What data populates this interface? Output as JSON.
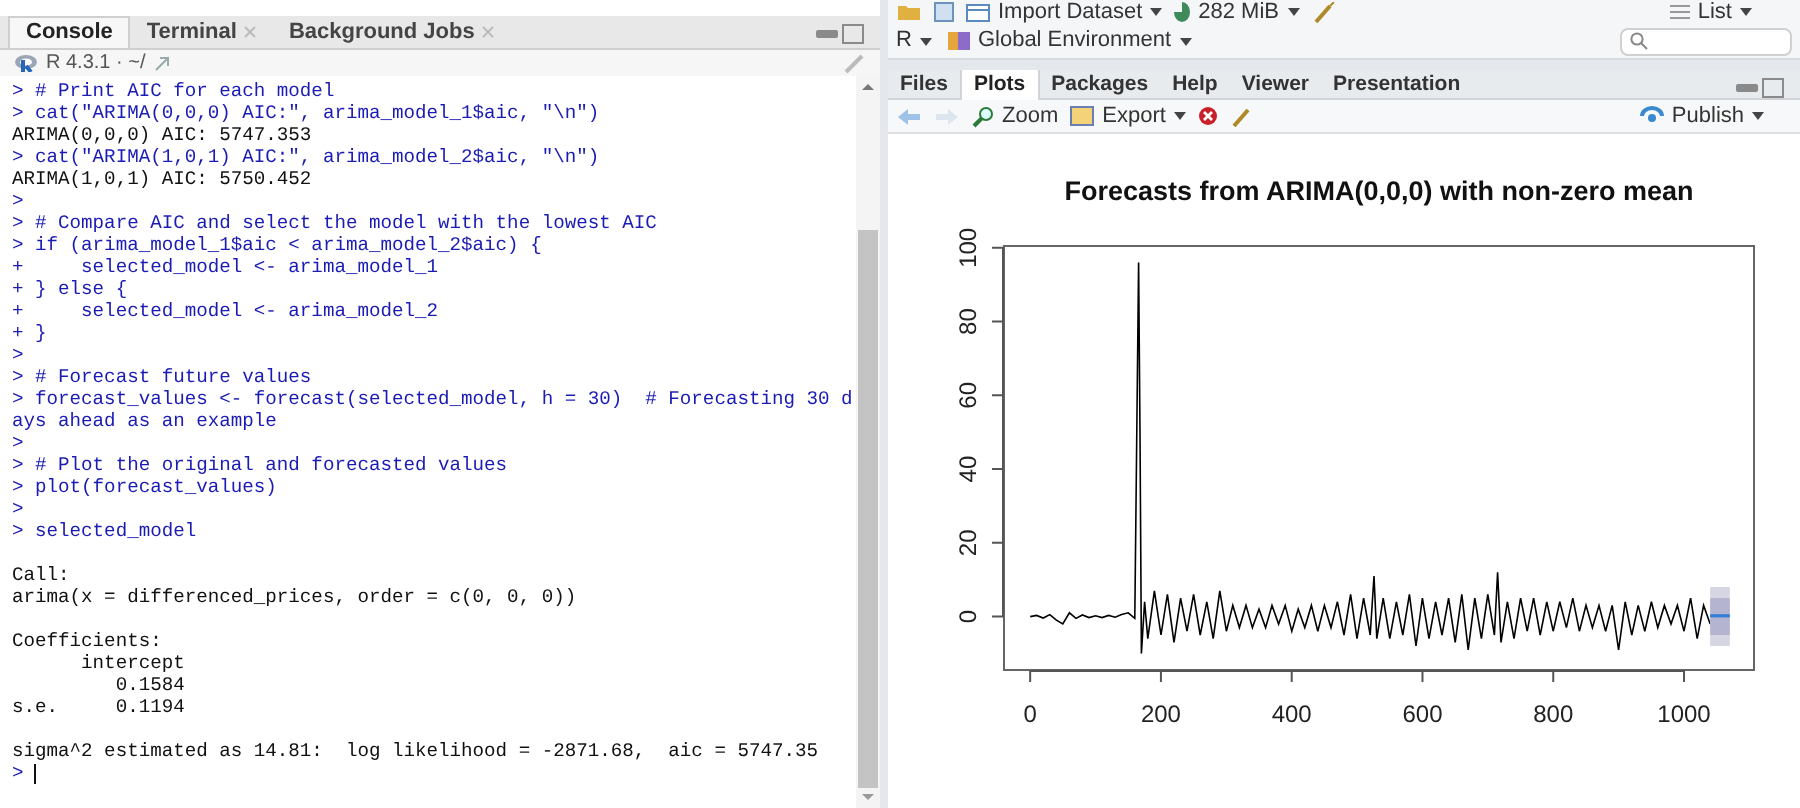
{
  "console": {
    "tabs": [
      {
        "label": "Console",
        "selected": true,
        "closable": false
      },
      {
        "label": "Terminal",
        "selected": false,
        "closable": true
      },
      {
        "label": "Background Jobs",
        "selected": false,
        "closable": true
      }
    ],
    "version_label": "R 4.3.1 · ~/",
    "lines": [
      {
        "kind": "input",
        "text": "> # Print AIC for each model"
      },
      {
        "kind": "input",
        "text": "> cat(\"ARIMA(0,0,0) AIC:\", arima_model_1$aic, \"\\n\")"
      },
      {
        "kind": "output",
        "text": "ARIMA(0,0,0) AIC: 5747.353"
      },
      {
        "kind": "input",
        "text": "> cat(\"ARIMA(1,0,1) AIC:\", arima_model_2$aic, \"\\n\")"
      },
      {
        "kind": "output",
        "text": "ARIMA(1,0,1) AIC: 5750.452"
      },
      {
        "kind": "input",
        "text": ">"
      },
      {
        "kind": "input",
        "text": "> # Compare AIC and select the model with the lowest AIC"
      },
      {
        "kind": "input",
        "text": "> if (arima_model_1$aic < arima_model_2$aic) {"
      },
      {
        "kind": "input",
        "text": "+     selected_model <- arima_model_1"
      },
      {
        "kind": "input",
        "text": "+ } else {"
      },
      {
        "kind": "input",
        "text": "+     selected_model <- arima_model_2"
      },
      {
        "kind": "input",
        "text": "+ }"
      },
      {
        "kind": "input",
        "text": ">"
      },
      {
        "kind": "input",
        "text": "> # Forecast future values"
      },
      {
        "kind": "input",
        "text": "> forecast_values <- forecast(selected_model, h = 30)  # Forecasting 30 d"
      },
      {
        "kind": "input",
        "text": "ays ahead as an example"
      },
      {
        "kind": "input",
        "text": ">"
      },
      {
        "kind": "input",
        "text": "> # Plot the original and forecasted values"
      },
      {
        "kind": "input",
        "text": "> plot(forecast_values)"
      },
      {
        "kind": "input",
        "text": ">"
      },
      {
        "kind": "input",
        "text": "> selected_model"
      },
      {
        "kind": "blank"
      },
      {
        "kind": "output",
        "text": "Call:"
      },
      {
        "kind": "output",
        "text": "arima(x = differenced_prices, order = c(0, 0, 0))"
      },
      {
        "kind": "blank"
      },
      {
        "kind": "output",
        "text": "Coefficients:"
      },
      {
        "kind": "output",
        "text": "      intercept"
      },
      {
        "kind": "output",
        "text": "         0.1584"
      },
      {
        "kind": "output",
        "text": "s.e.     0.1194"
      },
      {
        "kind": "blank"
      },
      {
        "kind": "output",
        "text": "sigma^2 estimated as 14.81:  log likelihood = -2871.68,  aic = 5747.35"
      },
      {
        "kind": "prompt",
        "text": ">"
      }
    ]
  },
  "environment_toolbar": {
    "import_button": "Import Dataset",
    "memory": "282 MiB",
    "view_mode": "List",
    "language": "R",
    "scope": "Global Environment"
  },
  "viewer": {
    "tabs": [
      {
        "label": "Files",
        "selected": false
      },
      {
        "label": "Plots",
        "selected": true
      },
      {
        "label": "Packages",
        "selected": false
      },
      {
        "label": "Help",
        "selected": false
      },
      {
        "label": "Viewer",
        "selected": false
      },
      {
        "label": "Presentation",
        "selected": false
      }
    ],
    "toolbar": {
      "zoom": "Zoom",
      "export": "Export",
      "publish": "Publish"
    },
    "chart_data": {
      "type": "line",
      "title": "Forecasts from ARIMA(0,0,0) with non-zero mean",
      "xlim": [
        -40,
        1107
      ],
      "ylim": [
        -14.5,
        100.5
      ],
      "xticks": [
        0,
        200,
        400,
        600,
        800,
        1000
      ],
      "yticks": [
        0,
        20,
        40,
        60,
        80,
        100
      ],
      "x": [
        0,
        10,
        20,
        30,
        40,
        50,
        60,
        70,
        80,
        90,
        100,
        110,
        120,
        130,
        140,
        150,
        160,
        166,
        168,
        170,
        175,
        180,
        190,
        200,
        210,
        220,
        230,
        240,
        250,
        260,
        270,
        280,
        290,
        300,
        310,
        320,
        330,
        340,
        350,
        360,
        370,
        380,
        390,
        400,
        410,
        420,
        430,
        440,
        450,
        460,
        470,
        480,
        490,
        500,
        510,
        520,
        526,
        530,
        540,
        550,
        560,
        570,
        580,
        590,
        600,
        610,
        620,
        630,
        640,
        650,
        660,
        670,
        680,
        690,
        700,
        710,
        715,
        720,
        730,
        740,
        750,
        760,
        770,
        780,
        790,
        800,
        810,
        820,
        830,
        840,
        850,
        860,
        870,
        880,
        890,
        900,
        910,
        920,
        930,
        940,
        950,
        960,
        970,
        980,
        990,
        1000,
        1010,
        1020,
        1030,
        1040,
        1070
      ],
      "series": [
        {
          "color": "#000000",
          "values": [
            0,
            0.3,
            -0.4,
            0.5,
            -1,
            -2,
            1,
            -0.5,
            0.4,
            -0.3,
            0.2,
            -0.3,
            0.3,
            -0.2,
            0.5,
            1,
            -0.5,
            96,
            50,
            -10,
            4,
            -6,
            7,
            -5,
            6,
            -7,
            5,
            -4,
            6,
            -5,
            4,
            -6,
            7,
            -4,
            3,
            -3,
            3,
            -3,
            2,
            -3,
            3,
            -2,
            3,
            -4,
            2,
            -3,
            3,
            -4,
            3,
            -3,
            4,
            -5,
            6,
            -6,
            5,
            -5,
            11,
            -6,
            5,
            -6,
            4,
            -5,
            6,
            -8,
            5,
            -6,
            4,
            -5,
            5,
            -7,
            6,
            -9,
            5,
            -6,
            6,
            -5,
            12,
            -7,
            4,
            -6,
            5,
            -4,
            5,
            -5,
            4,
            -4,
            4,
            -3,
            5,
            -4,
            3,
            -3,
            3,
            -4,
            3,
            -9,
            4,
            -5,
            3,
            -4,
            4,
            -3,
            3,
            -2,
            3,
            -4,
            5,
            -6,
            3,
            -2,
            null
          ]
        },
        {
          "color": "#2f7fd8",
          "values": [
            null,
            null,
            null,
            null,
            null,
            null,
            null,
            null,
            null,
            null,
            null,
            null,
            null,
            null,
            null,
            null,
            null,
            null,
            null,
            null,
            null,
            null,
            null,
            null,
            null,
            null,
            null,
            null,
            null,
            null,
            null,
            null,
            null,
            null,
            null,
            null,
            null,
            null,
            null,
            null,
            null,
            null,
            null,
            null,
            null,
            null,
            null,
            null,
            null,
            null,
            null,
            null,
            null,
            null,
            null,
            null,
            null,
            null,
            null,
            null,
            null,
            null,
            null,
            null,
            null,
            null,
            null,
            null,
            null,
            null,
            null,
            null,
            null,
            null,
            null,
            null,
            null,
            null,
            null,
            null,
            null,
            null,
            null,
            null,
            null,
            null,
            null,
            null,
            null,
            null,
            null,
            null,
            null,
            null,
            null,
            null,
            null,
            null,
            null,
            null,
            null,
            null,
            null,
            null,
            null,
            null,
            null,
            null,
            null,
            0.2,
            0.2
          ]
        }
      ]
    }
  }
}
